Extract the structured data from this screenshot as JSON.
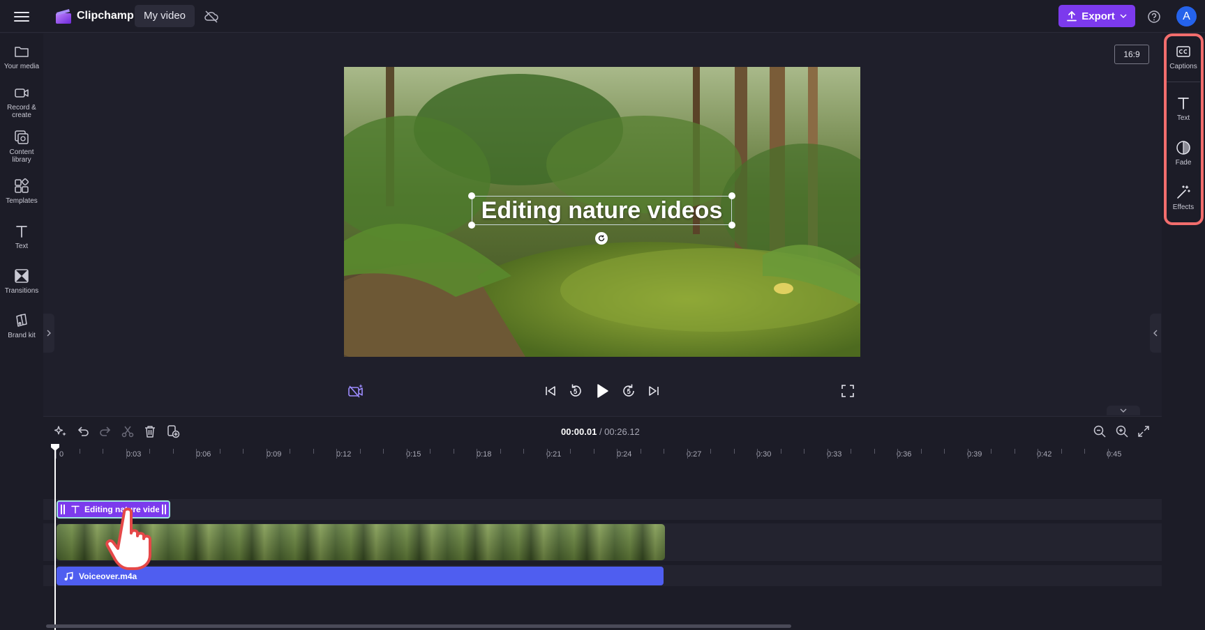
{
  "topbar": {
    "app_name": "Clipchamp",
    "project_name": "My video",
    "export_label": "Export",
    "avatar_initial": "A"
  },
  "left_sidebar": {
    "items": [
      {
        "label": "Your media",
        "icon": "folder-icon"
      },
      {
        "label": "Record & create",
        "icon": "camera-icon"
      },
      {
        "label": "Content library",
        "icon": "library-icon"
      },
      {
        "label": "Templates",
        "icon": "templates-icon"
      },
      {
        "label": "Text",
        "icon": "text-icon"
      },
      {
        "label": "Transitions",
        "icon": "transitions-icon"
      },
      {
        "label": "Brand kit",
        "icon": "brand-kit-icon"
      }
    ]
  },
  "right_sidebar": {
    "items": [
      {
        "label": "Captions",
        "icon": "captions-icon"
      },
      {
        "label": "Text",
        "icon": "text-icon"
      },
      {
        "label": "Fade",
        "icon": "fade-icon"
      },
      {
        "label": "Effects",
        "icon": "effects-icon"
      }
    ],
    "highlight_color": "#f26d6d"
  },
  "preview": {
    "aspect_ratio": "16:9",
    "overlay_text": "Editing nature videos"
  },
  "timeline": {
    "current_time": "00:00.01",
    "total_time": "/ 00:26.12",
    "ruler_labels": [
      "0",
      "0:03",
      "0:06",
      "0:09",
      "0:12",
      "0:15",
      "0:18",
      "0:21",
      "0:24",
      "0:27",
      "0:30",
      "0:33",
      "0:36",
      "0:39",
      "0:42",
      "0:45"
    ],
    "text_clip_label": "Editing nature videos",
    "audio_clip_label": "Voiceover.m4a"
  },
  "colors": {
    "accent": "#7c3aed",
    "audio_clip": "#4f5ef0",
    "background": "#1f1f2b",
    "panel": "#1c1c27"
  }
}
